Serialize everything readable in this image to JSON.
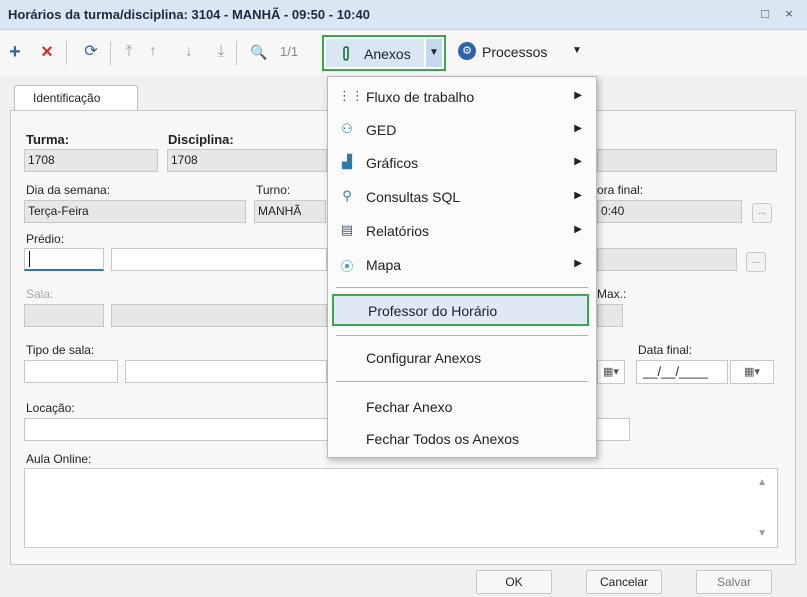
{
  "window": {
    "title": "Horários da turma/disciplina: 3104 - MANHÃ - 09:50 - 10:40",
    "maximize_glyph": "□",
    "close_glyph": "×"
  },
  "toolbar": {
    "add_glyph": "+",
    "delete_glyph": "×",
    "refresh_glyph": "⟳",
    "first_glyph": "⤒",
    "up_glyph": "↑",
    "down_glyph": "↓",
    "last_glyph": "⤓",
    "search_glyph": "🔍",
    "page": "1/1",
    "anexos_label": "Anexos",
    "anexos_arrow": "▼",
    "processos_label": "Processos",
    "processos_arrow": "▼"
  },
  "tabs": [
    {
      "label": "Identificação"
    }
  ],
  "form": {
    "turma_label": "Turma:",
    "turma_value": "1708",
    "disciplina_label": "Disciplina:",
    "disciplina_value": "1708",
    "dia_label": "Dia da semana:",
    "dia_value": "Terça-Feira",
    "turno_label": "Turno:",
    "turno_value": "MANHÃ",
    "hora_final_label": "ora final:",
    "hora_final_value": "0:40",
    "predio_label": "Prédio:",
    "sala_label": "Sala:",
    "max_label": "Max.:",
    "tipo_sala_label": "Tipo de sala:",
    "data_final_label": "Data final:",
    "data_final_value": "__/__/____",
    "locacao_label": "Locação:",
    "aula_online_label": "Aula Online:",
    "ellipsis": "..."
  },
  "menu": {
    "items": [
      {
        "label": "Fluxo de trabalho",
        "icon": "workflow-icon",
        "submenu": true
      },
      {
        "label": "GED",
        "icon": "ged-icon",
        "submenu": true
      },
      {
        "label": "Gráficos",
        "icon": "chart-icon",
        "submenu": true
      },
      {
        "label": "Consultas SQL",
        "icon": "search-icon",
        "submenu": true
      },
      {
        "label": "Relatórios",
        "icon": "report-icon",
        "submenu": true
      },
      {
        "label": "Mapa",
        "icon": "map-pin-icon",
        "submenu": true
      }
    ],
    "highlighted": "Professor do Horário",
    "configurar": "Configurar Anexos",
    "fechar": "Fechar Anexo",
    "fechar_todos": "Fechar Todos os Anexos",
    "arrow": "▶"
  },
  "buttons": {
    "ok": "OK",
    "cancelar": "Cancelar",
    "salvar": "Salvar"
  },
  "colors": {
    "accent_green": "#3aa84a",
    "titlebar": "#dbe6f3",
    "focus_blue": "#2d74c4"
  }
}
